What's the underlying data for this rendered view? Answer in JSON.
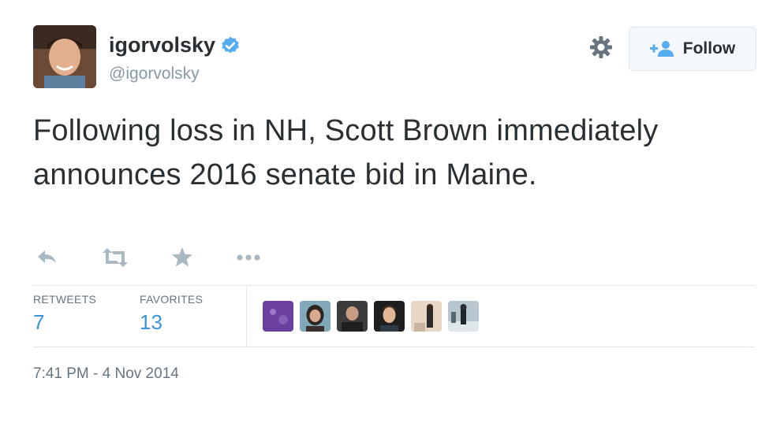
{
  "user": {
    "display_name": "igorvolsky",
    "handle": "@igorvolsky",
    "verified": true,
    "avatar_icon": "profile-photo"
  },
  "header": {
    "settings_icon": "gear-icon",
    "follow_label": "Follow",
    "follow_icon": "add-user-icon"
  },
  "tweet": {
    "text": "Following loss in NH, Scott Brown immediately announces 2016 senate bid in Maine."
  },
  "actions": [
    {
      "name": "reply",
      "icon": "reply-icon"
    },
    {
      "name": "retweet",
      "icon": "retweet-icon"
    },
    {
      "name": "favorite",
      "icon": "star-icon"
    },
    {
      "name": "more",
      "icon": "more-dots-icon"
    }
  ],
  "stats": {
    "retweets_label": "RETWEETS",
    "retweets_value": "7",
    "favorites_label": "FAVORITES",
    "favorites_value": "13"
  },
  "favoriters": [
    {
      "icon": "favoriter-avatar-1"
    },
    {
      "icon": "favoriter-avatar-2"
    },
    {
      "icon": "favoriter-avatar-3"
    },
    {
      "icon": "favoriter-avatar-4"
    },
    {
      "icon": "favoriter-avatar-5"
    },
    {
      "icon": "favoriter-avatar-6"
    }
  ],
  "timestamp": "7:41 PM - 4 Nov 2014",
  "colors": {
    "text": "#292f33",
    "muted": "#8899a6",
    "link": "#3b94d9",
    "verified": "#55acee",
    "border": "#e1e8ed"
  }
}
